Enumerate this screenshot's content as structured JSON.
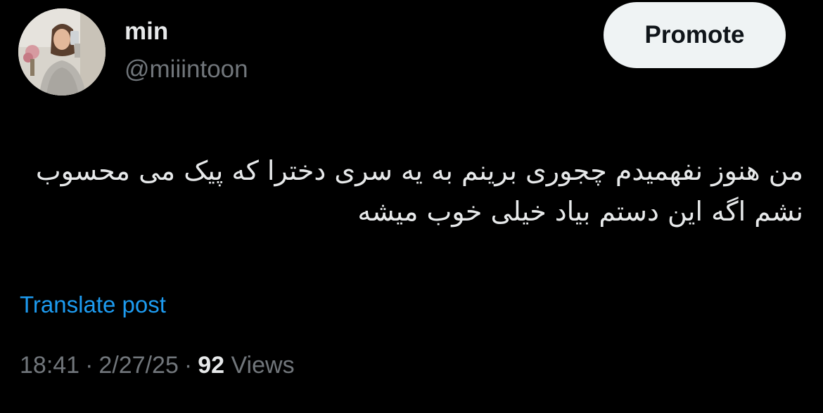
{
  "author": {
    "display_name": "min",
    "handle": "@miiintoon"
  },
  "header": {
    "promote_label": "Promote"
  },
  "post": {
    "text": "من هنوز نفهمیدم چجوری برینم به یه سری دخترا که پیک می محسوب نشم اگه این دستم بیاد خیلی خوب میشه",
    "translate_label": "Translate post"
  },
  "meta": {
    "time": "18:41",
    "separator": "·",
    "date": "2/27/25",
    "views_count": "92",
    "views_label": "Views"
  },
  "colors": {
    "background": "#000000",
    "primary_text": "#e7e9ea",
    "secondary_text": "#71767b",
    "link": "#1d9bf0",
    "button_bg": "#eff3f4"
  }
}
